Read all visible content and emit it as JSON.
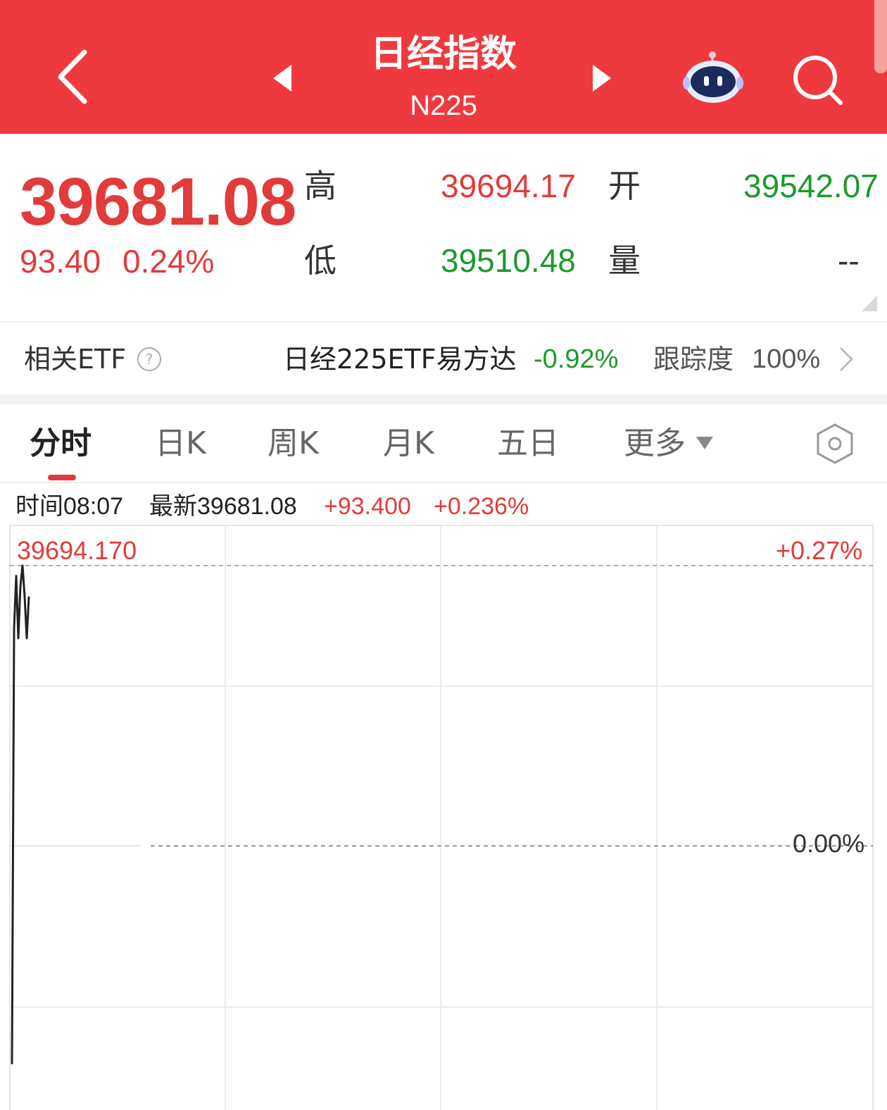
{
  "header": {
    "title": "日经指数",
    "subtitle": "N225",
    "bg_color": "#ee3a3f"
  },
  "quote": {
    "price": "39681.08",
    "change": "93.40",
    "change_pct": "0.24%",
    "high_label": "高",
    "high_value": "39694.17",
    "open_label": "开",
    "open_value": "39542.07",
    "low_label": "低",
    "low_value": "39510.48",
    "volume_label": "量",
    "volume_value": "--"
  },
  "etf": {
    "label": "相关ETF",
    "name": "日经225ETF易方达",
    "change": "-0.92%",
    "tracking_label": "跟踪度",
    "tracking_value": "100%"
  },
  "tabs": [
    {
      "label": "分时",
      "active": true
    },
    {
      "label": "日K",
      "active": false
    },
    {
      "label": "周K",
      "active": false
    },
    {
      "label": "月K",
      "active": false
    },
    {
      "label": "五日",
      "active": false
    },
    {
      "label": "更多",
      "active": false
    }
  ],
  "info": {
    "time": "时间08:07",
    "latest": "最新39681.08",
    "change": "+93.400",
    "change_pct": "+0.236%"
  },
  "chart_data": {
    "type": "line",
    "top_price_label": "39694.170",
    "top_pct_label": "+0.27%",
    "mid_pct_label": "0.00%",
    "y_range_pct": [
      -0.27,
      0.27
    ],
    "x": [
      0,
      1,
      2,
      3,
      4,
      5,
      6,
      7,
      8
    ],
    "series": [
      {
        "values": [
          -0.21,
          0.21,
          0.26,
          0.2,
          0.25,
          0.27,
          0.24,
          0.2,
          0.24
        ],
        "color": "#222222"
      }
    ]
  },
  "colors": {
    "up": "#e23b3b",
    "down": "#1c9a2c"
  }
}
